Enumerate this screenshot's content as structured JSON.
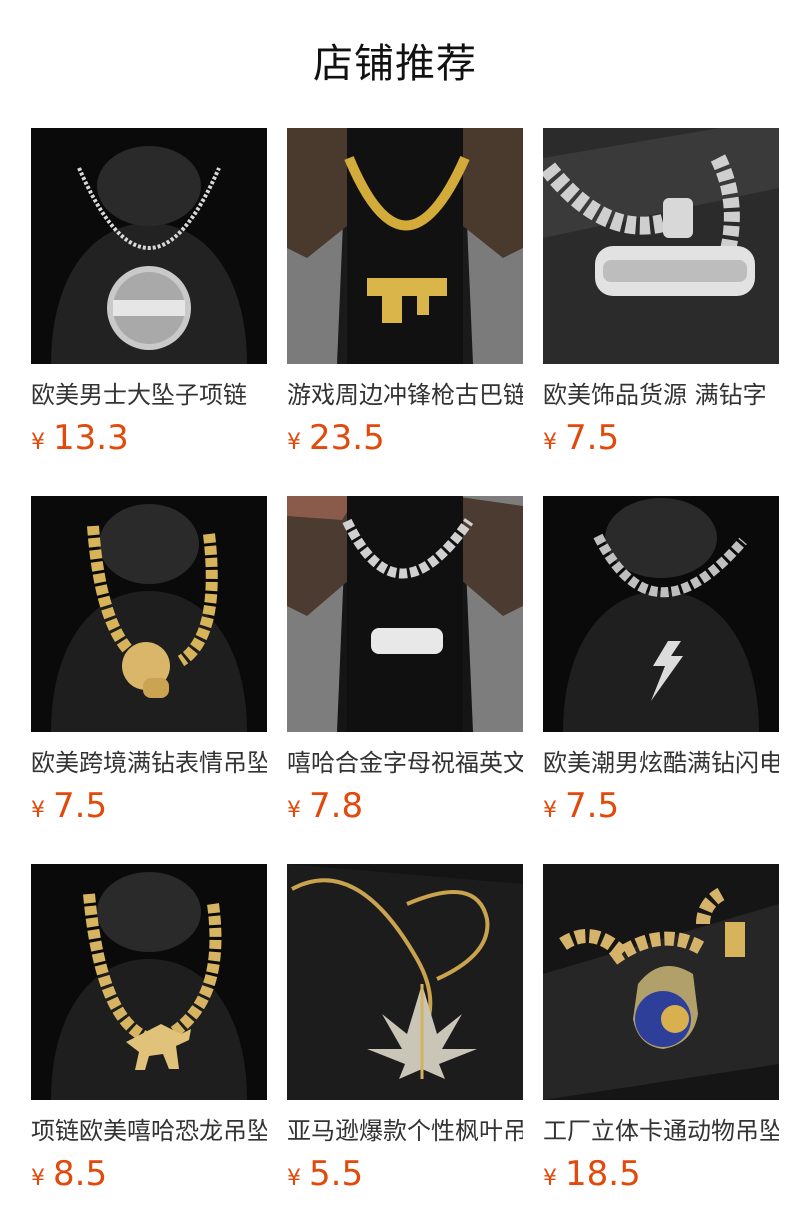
{
  "header": {
    "title": "店铺推荐"
  },
  "currency_symbol": "¥",
  "colors": {
    "price": "#e24a0b",
    "text": "#333333",
    "title": "#111111"
  },
  "products": [
    {
      "name": "欧美男士大坠子项链",
      "price": "13.3",
      "image_icon": "silver-necklace-round-pendant-on-bust"
    },
    {
      "name": "游戏周边冲锋枪古巴链",
      "price": "23.5",
      "image_icon": "gold-chain-gun-pendant-on-model"
    },
    {
      "name": "欧美饰品货源 满钻字",
      "price": "7.5",
      "image_icon": "silver-chain-savage-pendant"
    },
    {
      "name": "欧美跨境满钻表情吊坠",
      "price": "7.5",
      "image_icon": "gold-chain-emoji-pendant-on-bust"
    },
    {
      "name": "嘻哈合金字母祝福英文",
      "price": "7.8",
      "image_icon": "silver-chain-bless-pendant-on-model"
    },
    {
      "name": "欧美潮男炫酷满钻闪电",
      "price": "7.5",
      "image_icon": "silver-chain-lightning-pendant-on-bust"
    },
    {
      "name": "项链欧美嘻哈恐龙吊坠",
      "price": "8.5",
      "image_icon": "gold-chain-dinosaur-pendant-on-bust"
    },
    {
      "name": "亚马逊爆款个性枫叶吊坠",
      "price": "5.5",
      "image_icon": "gold-rope-chain-leaf-pendant"
    },
    {
      "name": "工厂立体卡通动物吊坠",
      "price": "18.5",
      "image_icon": "gold-chain-cartoon-animal-pendant"
    }
  ]
}
